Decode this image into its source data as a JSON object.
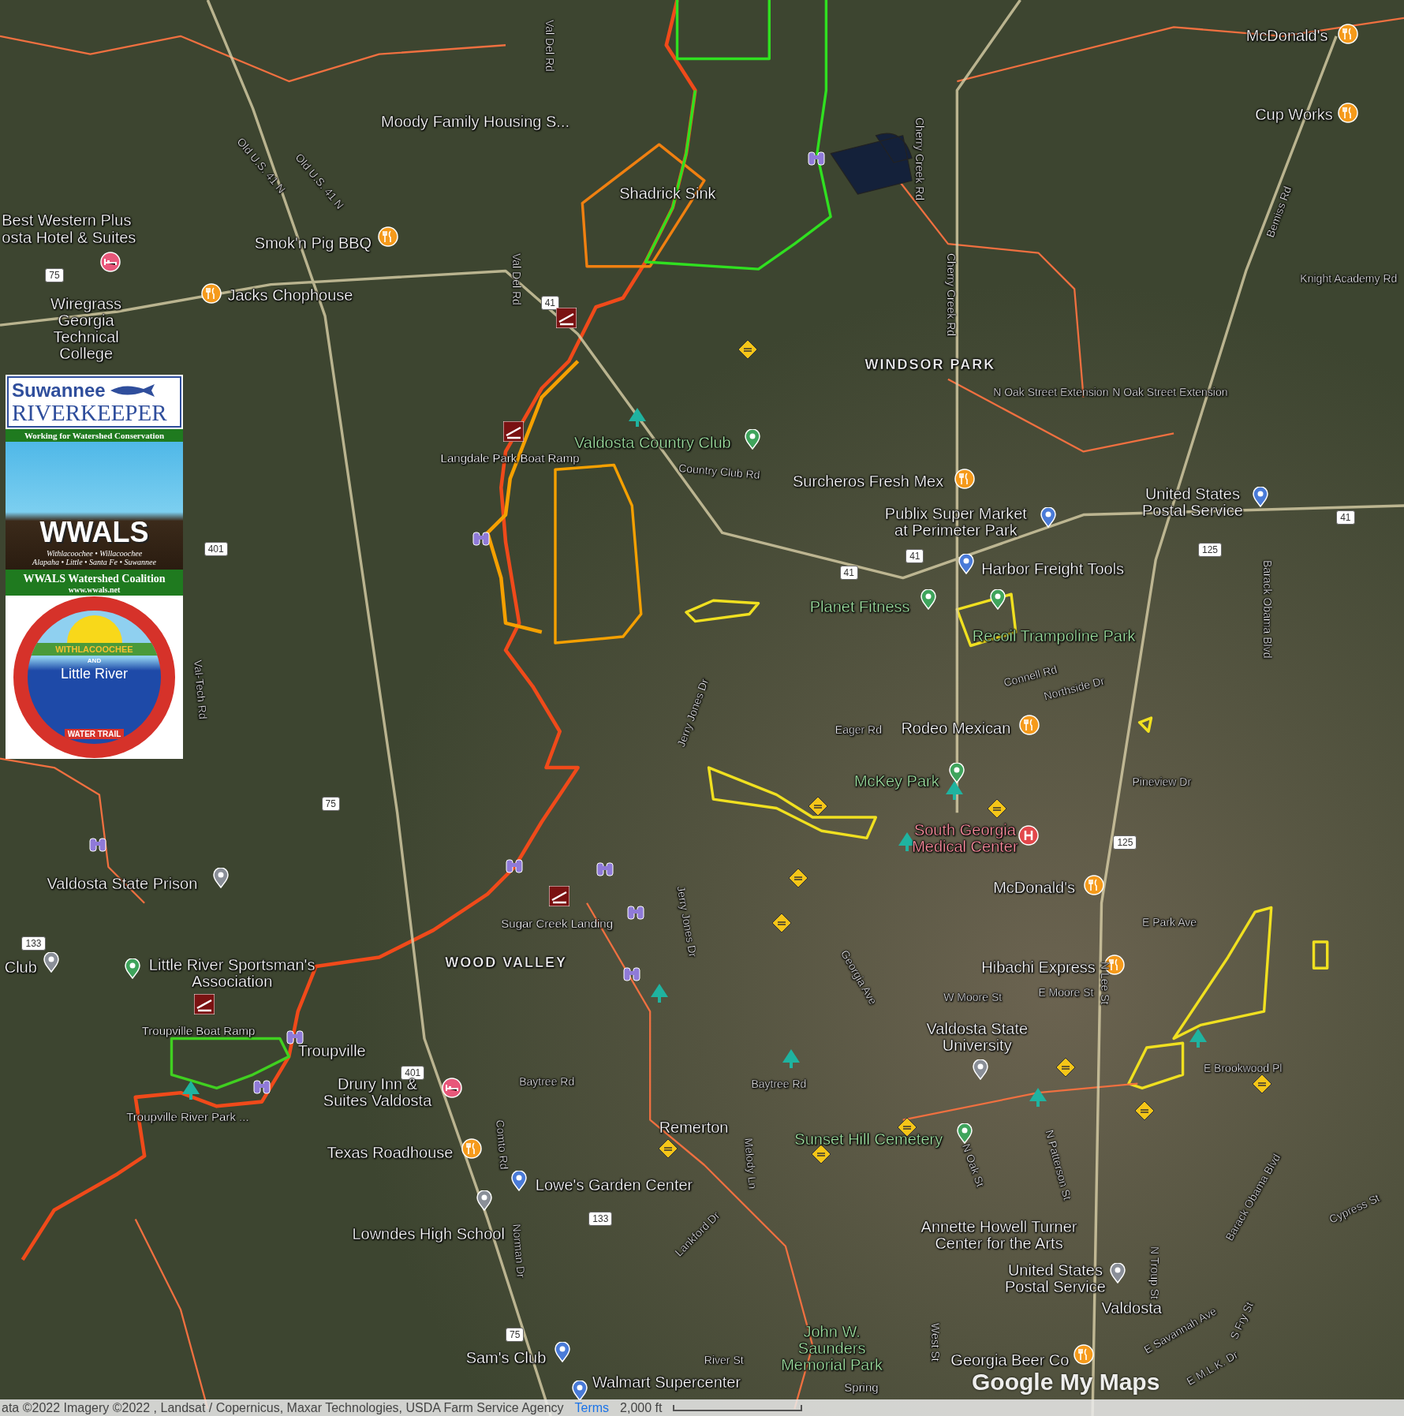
{
  "map": {
    "labels": [
      {
        "text": "Moody Family Housing S...",
        "kind": "place"
      },
      {
        "text": "Shadrick Sink",
        "kind": "place"
      },
      {
        "text": "Best Western Plus",
        "kind": "place"
      },
      {
        "text": "osta Hotel & Suites",
        "kind": "place"
      },
      {
        "text": "Smok'n Pig BBQ",
        "kind": "place"
      },
      {
        "text": "Jacks Chophouse",
        "kind": "place"
      },
      {
        "text": "Wiregrass\nGeorgia\nTechnical\nCollege",
        "kind": "place"
      },
      {
        "text": "Langdale Park Boat Ramp",
        "kind": "small"
      },
      {
        "text": "Valdosta Country Club",
        "kind": "park"
      },
      {
        "text": "Country Club Rd",
        "kind": "road"
      },
      {
        "text": "WINDSOR PARK",
        "kind": "area"
      },
      {
        "text": "Surcheros Fresh Mex",
        "kind": "place"
      },
      {
        "text": "Publix Super Market\nat Perimeter Park",
        "kind": "place"
      },
      {
        "text": "United States\nPostal Service",
        "kind": "place"
      },
      {
        "text": "Harbor Freight Tools",
        "kind": "place"
      },
      {
        "text": "Planet Fitness",
        "kind": "park"
      },
      {
        "text": "Recoil Trampoline Park",
        "kind": "park"
      },
      {
        "text": "McDonald's",
        "kind": "place"
      },
      {
        "text": "Cup Works",
        "kind": "place"
      },
      {
        "text": "Knight Academy Rd",
        "kind": "road"
      },
      {
        "text": "N Oak Street Extension",
        "kind": "road"
      },
      {
        "text": "N Oak Street Extension",
        "kind": "road"
      },
      {
        "text": "Cherry Creek Rd",
        "kind": "road"
      },
      {
        "text": "Cherry Creek Rd",
        "kind": "road"
      },
      {
        "text": "Val Del Rd",
        "kind": "road"
      },
      {
        "text": "Val Del Rd",
        "kind": "road"
      },
      {
        "text": "Old U.S. 41 N",
        "kind": "road"
      },
      {
        "text": "Old U.S. 41 N",
        "kind": "road"
      },
      {
        "text": "Bemiss Rd",
        "kind": "road"
      },
      {
        "text": "Barack Obama Blvd",
        "kind": "road"
      },
      {
        "text": "Rodeo Mexican",
        "kind": "place"
      },
      {
        "text": "Eager Rd",
        "kind": "road"
      },
      {
        "text": "Jerry Jones Dr",
        "kind": "road"
      },
      {
        "text": "Connell Rd",
        "kind": "road"
      },
      {
        "text": "Northside Dr",
        "kind": "road"
      },
      {
        "text": "Pineview Dr",
        "kind": "road"
      },
      {
        "text": "McKey Park",
        "kind": "park"
      },
      {
        "text": "South Georgia\nMedical Center",
        "kind": "hospital"
      },
      {
        "text": "Valdosta State Prison",
        "kind": "place"
      },
      {
        "text": "McDonald's",
        "kind": "place"
      },
      {
        "text": "E Park Ave",
        "kind": "road"
      },
      {
        "text": "Hibachi Express",
        "kind": "place"
      },
      {
        "text": "W Moore St",
        "kind": "road"
      },
      {
        "text": "E Moore St",
        "kind": "road"
      },
      {
        "text": "Valdosta State\nUniversity",
        "kind": "place"
      },
      {
        "text": "Georgia Ave",
        "kind": "road"
      },
      {
        "text": "Jerry Jones Dr",
        "kind": "road"
      },
      {
        "text": "Val-Tech Rd",
        "kind": "road"
      },
      {
        "text": "Club",
        "kind": "place"
      },
      {
        "text": "Little River Sportsman's\nAssociation",
        "kind": "place"
      },
      {
        "text": "WOOD VALLEY",
        "kind": "area"
      },
      {
        "text": "Sugar Creek Landing",
        "kind": "small"
      },
      {
        "text": "Troupville Boat Ramp",
        "kind": "small"
      },
      {
        "text": "Troupville",
        "kind": "place"
      },
      {
        "text": "Drury Inn &\nSuites Valdosta",
        "kind": "place"
      },
      {
        "text": "Troupville River Park ...",
        "kind": "small"
      },
      {
        "text": "Baytree Rd",
        "kind": "road"
      },
      {
        "text": "Baytree Rd",
        "kind": "road"
      },
      {
        "text": "Remerton",
        "kind": "place"
      },
      {
        "text": "Sunset Hill Cemetery",
        "kind": "park"
      },
      {
        "text": "E Brookwood Pl",
        "kind": "road"
      },
      {
        "text": "Texas Roadhouse",
        "kind": "place"
      },
      {
        "text": "Lowe's Garden Center",
        "kind": "place"
      },
      {
        "text": "Comto Rd",
        "kind": "road"
      },
      {
        "text": "Norman Dr",
        "kind": "road"
      },
      {
        "text": "Melody Ln",
        "kind": "road"
      },
      {
        "text": "Lankford Dr",
        "kind": "road"
      },
      {
        "text": "Lowndes High School",
        "kind": "place"
      },
      {
        "text": "N Oak St",
        "kind": "road"
      },
      {
        "text": "N Patterson St",
        "kind": "road"
      },
      {
        "text": "N Lee St",
        "kind": "road"
      },
      {
        "text": "N Troup St",
        "kind": "road"
      },
      {
        "text": "Annette Howell Turner\nCenter for the Arts",
        "kind": "place"
      },
      {
        "text": "United States\nPostal Service",
        "kind": "place"
      },
      {
        "text": "Valdosta",
        "kind": "place"
      },
      {
        "text": "Barack Obama Blvd",
        "kind": "road"
      },
      {
        "text": "Cypress St",
        "kind": "road"
      },
      {
        "text": "West St",
        "kind": "road"
      },
      {
        "text": "E Savannah Ave",
        "kind": "road"
      },
      {
        "text": "S Fry St",
        "kind": "road"
      },
      {
        "text": "E M.L.K. Dr",
        "kind": "road"
      },
      {
        "text": "Sam's Club",
        "kind": "place"
      },
      {
        "text": "River St",
        "kind": "road"
      },
      {
        "text": "Walmart Supercenter",
        "kind": "place"
      },
      {
        "text": "John W.\nSaunders\nMemorial Park",
        "kind": "park"
      },
      {
        "text": "Spring",
        "kind": "small"
      },
      {
        "text": "Georgia Beer Co",
        "kind": "place"
      }
    ],
    "shields": [
      "41",
      "41",
      "41",
      "41",
      "75",
      "75",
      "75",
      "401",
      "401",
      "133",
      "133",
      "125",
      "125"
    ]
  },
  "logo_panel": {
    "riverkeeper": "Suwannee",
    "riverkeeper_sub": "RIVERKEEPER",
    "tagline": "Working for Watershed Conservation",
    "wwals": "WWALS",
    "rivers_1": "Withlacoochee • Willacoochee",
    "rivers_2": "Alapaha • Little • Santa Fe • Suwannee",
    "coalition": "WWALS Watershed Coalition",
    "url": "www.wwals.net",
    "trail_top": "WITHLACOOCHEE",
    "trail_and": "AND",
    "trail_name": "Little River",
    "trail_bottom": "WATER TRAIL"
  },
  "attribution": {
    "text": "ata ©2022 Imagery ©2022 , Landsat / Copernicus, Maxar Technologies, USDA Farm Service Agency",
    "terms": "Terms",
    "scale": "2,000 ft"
  },
  "brand": "Google My Maps"
}
